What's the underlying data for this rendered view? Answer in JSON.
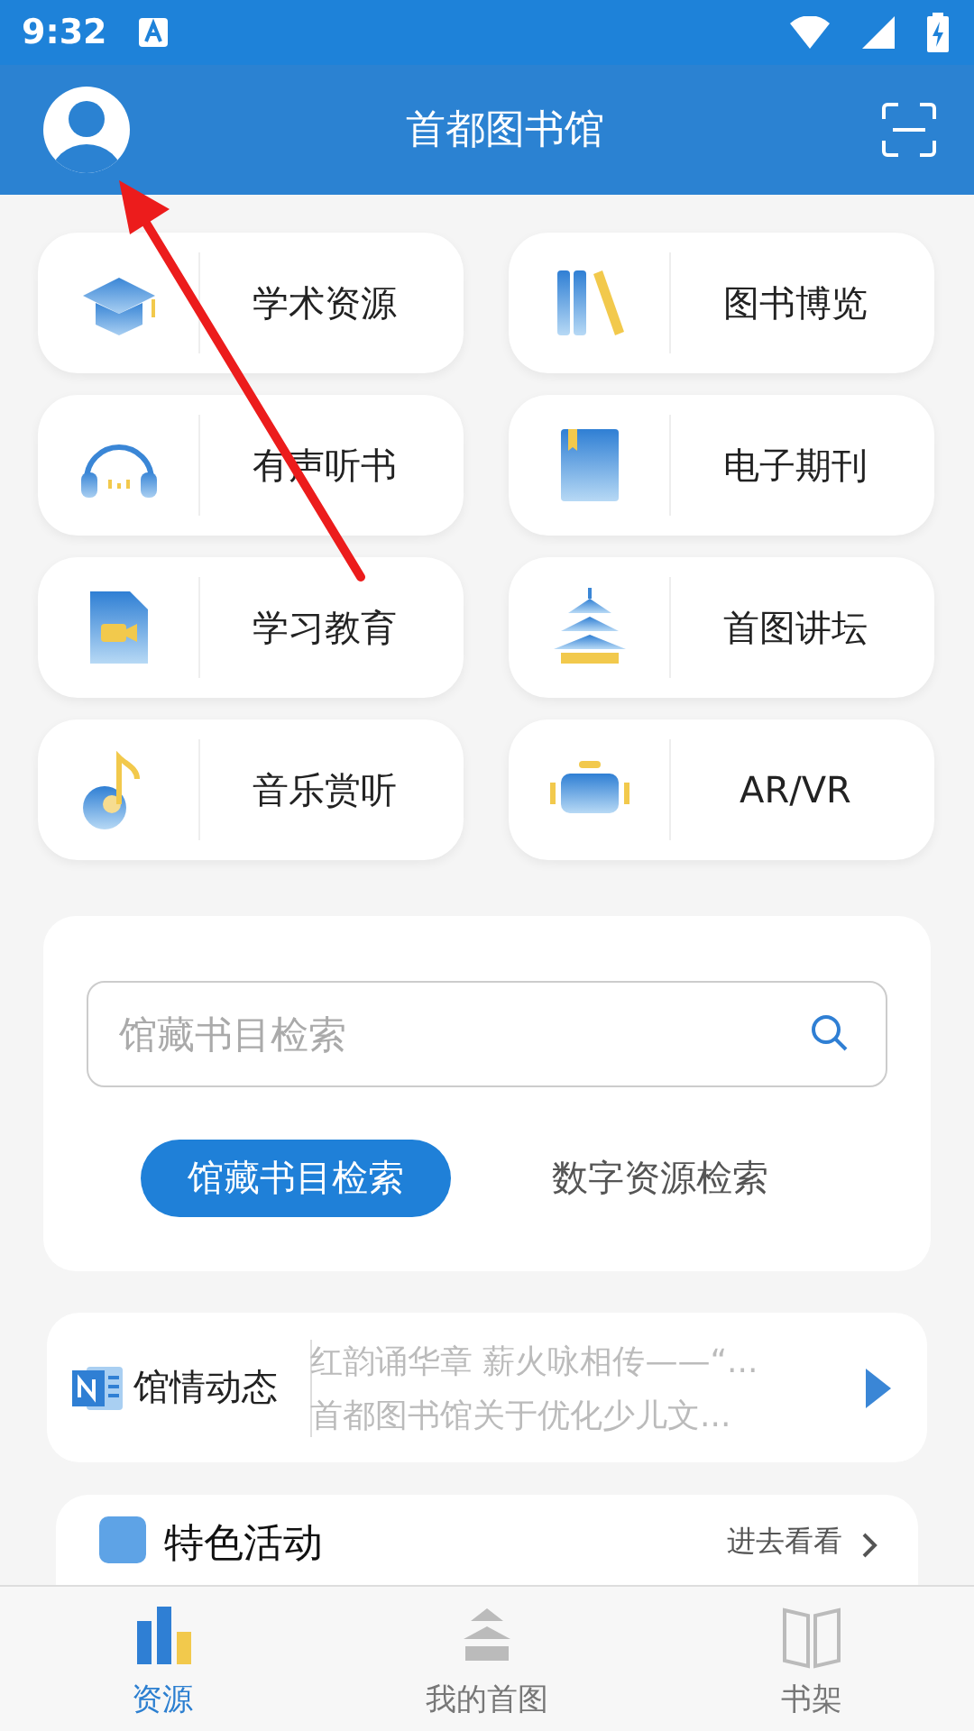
{
  "status_bar": {
    "time": "9:32"
  },
  "header": {
    "title": "首都图书馆"
  },
  "tiles": [
    {
      "label": "学术资源"
    },
    {
      "label": "图书博览"
    },
    {
      "label": "有声听书"
    },
    {
      "label": "电子期刊"
    },
    {
      "label": "学习教育"
    },
    {
      "label": "首图讲坛"
    },
    {
      "label": "音乐赏听"
    },
    {
      "label": "AR/VR"
    }
  ],
  "search": {
    "placeholder": "馆藏书目检索",
    "modes": [
      {
        "label": "馆藏书目检索",
        "selected": true
      },
      {
        "label": "数字资源检索",
        "selected": false
      }
    ]
  },
  "news": {
    "title": "馆情动态",
    "items": [
      "红韵诵华章 薪火咏相传——“...",
      "首都图书馆关于优化少儿文..."
    ]
  },
  "featured": {
    "title": "特色活动",
    "link": "进去看看"
  },
  "tab_bar": [
    {
      "label": "资源",
      "selected": true
    },
    {
      "label": "我的首图",
      "selected": false
    },
    {
      "label": "书架",
      "selected": false
    }
  ]
}
